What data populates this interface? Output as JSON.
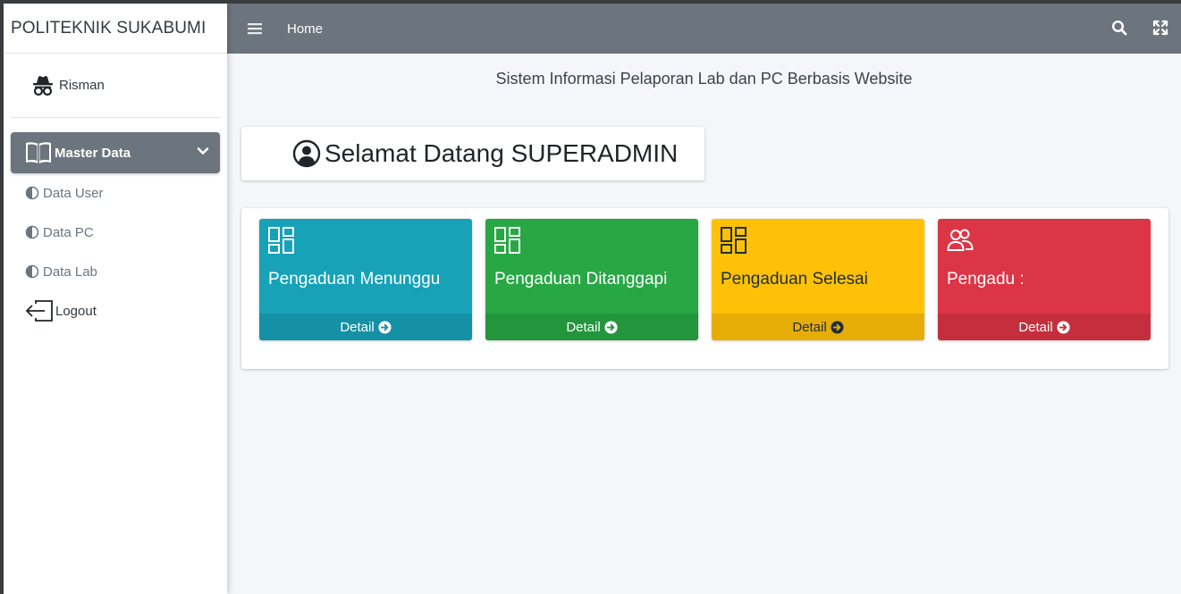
{
  "brand": {
    "title": "POLITEKNIK SUKABUMI"
  },
  "user": {
    "name": "Risman",
    "icon": "user-secret-icon"
  },
  "sidebar": {
    "master": {
      "label": "Master Data",
      "icon": "book-open-icon"
    },
    "items": [
      {
        "label": "Data User",
        "icon": "half-circle-icon"
      },
      {
        "label": "Data PC",
        "icon": "half-circle-icon"
      },
      {
        "label": "Data Lab",
        "icon": "half-circle-icon"
      }
    ],
    "logout": {
      "label": "Logout",
      "icon": "logout-icon"
    }
  },
  "navbar": {
    "home": "Home",
    "icons": [
      "menu-icon",
      "search-icon",
      "fullscreen-icon"
    ]
  },
  "content": {
    "system_title": "Sistem Informasi Pelaporan Lab dan PC Berbasis Website",
    "welcome": "Selamat Datang SUPERADMIN",
    "boxes": [
      {
        "title": "Pengaduan Menunggu",
        "footer": "Detail",
        "color": "#17a2b8",
        "icon": "grid-icon"
      },
      {
        "title": "Pengaduan Ditanggapi",
        "footer": "Detail",
        "color": "#28a745",
        "icon": "grid-icon"
      },
      {
        "title": "Pengaduan Selesai",
        "footer": "Detail",
        "color": "#ffc107",
        "icon": "grid-icon"
      },
      {
        "title": "Pengadu :",
        "footer": "Detail",
        "color": "#dc3545",
        "icon": "people-icon"
      }
    ]
  },
  "colors": {
    "navbar": "#6c757d",
    "sidebar_active": "#6c757d",
    "background": "#f4f6f9"
  }
}
